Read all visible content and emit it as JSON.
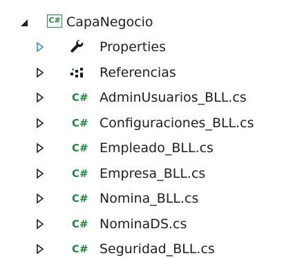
{
  "project": {
    "name": "CapaNegocio",
    "icon": "csharp-project-icon",
    "badge": "C#",
    "expanded": true
  },
  "items": [
    {
      "label": "Properties",
      "icon": "wrench-icon",
      "highlighted_expander": true
    },
    {
      "label": "Referencias",
      "icon": "references-icon",
      "highlighted_expander": false
    },
    {
      "label": "AdminUsuarios_BLL.cs",
      "icon": "csharp-file-icon",
      "badge": "C#",
      "highlighted_expander": false
    },
    {
      "label": "Configuraciones_BLL.cs",
      "icon": "csharp-file-icon",
      "badge": "C#",
      "highlighted_expander": false
    },
    {
      "label": "Empleado_BLL.cs",
      "icon": "csharp-file-icon",
      "badge": "C#",
      "highlighted_expander": false
    },
    {
      "label": "Empresa_BLL.cs",
      "icon": "csharp-file-icon",
      "badge": "C#",
      "highlighted_expander": false
    },
    {
      "label": "Nomina_BLL.cs",
      "icon": "csharp-file-icon",
      "badge": "C#",
      "highlighted_expander": false
    },
    {
      "label": "NominaDS.cs",
      "icon": "csharp-file-icon",
      "badge": "C#",
      "highlighted_expander": false
    },
    {
      "label": "Seguridad_BLL.cs",
      "icon": "csharp-file-icon",
      "badge": "C#",
      "highlighted_expander": false
    }
  ],
  "colors": {
    "text": "#1e1e1e",
    "csharp_green": "#1c8a3c",
    "expander_dark": "#1e1e1e",
    "expander_highlight": "#2f8fdd",
    "background": "#ffffff"
  }
}
